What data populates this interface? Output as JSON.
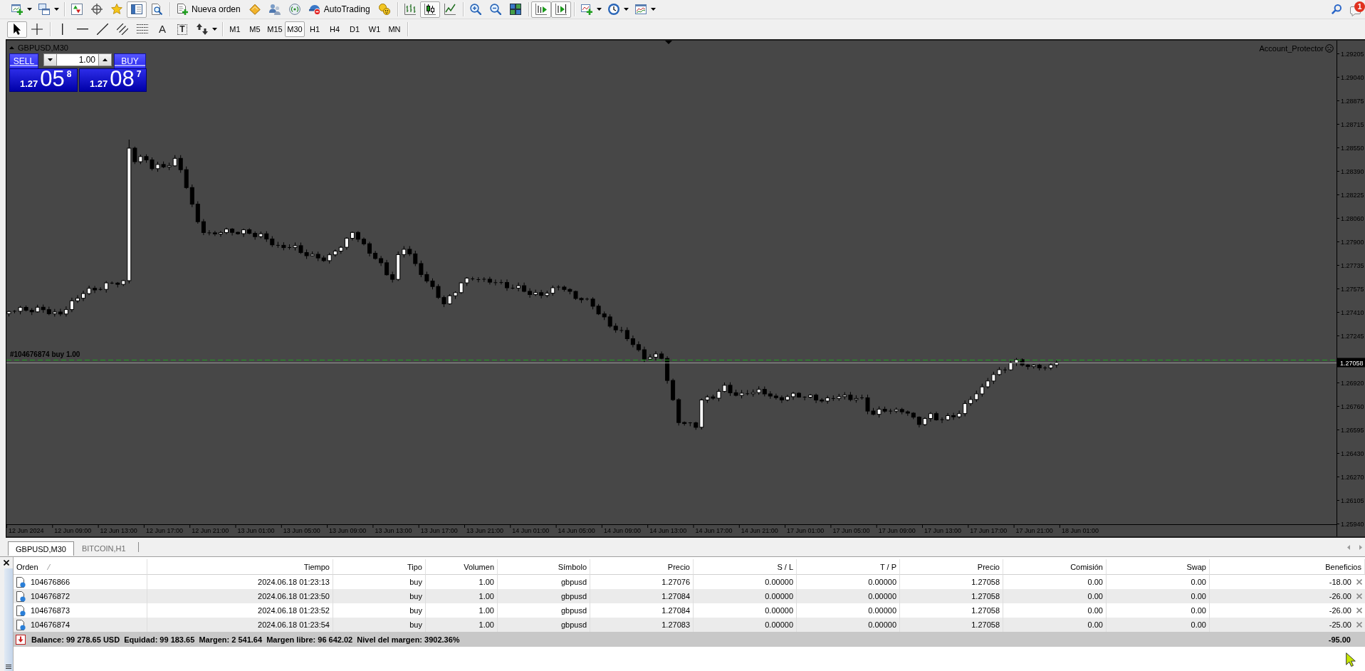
{
  "toolbar": {
    "items": [
      {
        "kind": "newchart",
        "on": false
      },
      {
        "kind": "profiles",
        "on": false
      },
      {
        "kind": "separator"
      },
      {
        "kind": "market",
        "on": false
      },
      {
        "kind": "navigator",
        "on": false
      },
      {
        "kind": "favorites",
        "on": false
      },
      {
        "kind": "datawindow",
        "on": true
      },
      {
        "kind": "tester",
        "on": false
      },
      {
        "kind": "separator"
      },
      {
        "kind": "order",
        "label": "Nueva orden",
        "on": false
      },
      {
        "kind": "editor",
        "on": false
      },
      {
        "kind": "terminal",
        "on": false
      },
      {
        "kind": "signals",
        "on": false
      },
      {
        "kind": "autotrading",
        "label": "AutoTrading",
        "on": false
      },
      {
        "kind": "experts",
        "on": false
      },
      {
        "kind": "separator"
      },
      {
        "kind": "bars",
        "on": false
      },
      {
        "kind": "candles",
        "on": true
      },
      {
        "kind": "line",
        "on": false
      },
      {
        "kind": "separator"
      },
      {
        "kind": "zoomin",
        "on": false
      },
      {
        "kind": "zoomout",
        "on": false
      },
      {
        "kind": "tile",
        "on": false
      },
      {
        "kind": "separator"
      },
      {
        "kind": "shift",
        "on": true
      },
      {
        "kind": "autoscroll",
        "on": true
      },
      {
        "kind": "separator"
      },
      {
        "kind": "indicators",
        "on": false
      },
      {
        "kind": "periods",
        "on": false
      },
      {
        "kind": "templates",
        "on": false
      }
    ]
  },
  "notifications": {
    "count": "1"
  },
  "drawing_toolbar": {
    "tools": [
      {
        "kind": "cursor",
        "on": true
      },
      {
        "kind": "crosshair",
        "on": false
      },
      {
        "kind": "separator"
      },
      {
        "kind": "vline",
        "on": false
      },
      {
        "kind": "hline",
        "on": false
      },
      {
        "kind": "trend",
        "on": false
      },
      {
        "kind": "channel",
        "on": false
      },
      {
        "kind": "fibo",
        "on": false
      },
      {
        "kind": "text",
        "glyph": "A",
        "on": false
      },
      {
        "kind": "label",
        "glyph": "T",
        "on": false
      },
      {
        "kind": "arrows",
        "on": false
      },
      {
        "kind": "separator"
      }
    ],
    "periods": [
      {
        "label": "M1",
        "selected": false
      },
      {
        "label": "M5",
        "selected": false
      },
      {
        "label": "M15",
        "selected": false
      },
      {
        "label": "M30",
        "selected": true
      },
      {
        "label": "H1",
        "selected": false
      },
      {
        "label": "H4",
        "selected": false
      },
      {
        "label": "D1",
        "selected": false
      },
      {
        "label": "W1",
        "selected": false
      },
      {
        "label": "MN",
        "selected": false
      }
    ]
  },
  "chart": {
    "symbol": "GBPUSD,M30",
    "expert": {
      "name": "Account_Protector",
      "active": false
    },
    "trade_panel": {
      "sell_label": "SELL",
      "buy_label": "BUY",
      "lot": "1.00",
      "sell_price": {
        "prefix": "1.27",
        "pips": "05",
        "fraction": "8"
      },
      "buy_price": {
        "prefix": "1.27",
        "pips": "08",
        "fraction": "7"
      }
    },
    "order_line_label": "#104676874 buy 1.00",
    "price_axis": [
      {
        "kind": "tick",
        "label": "1.29205"
      },
      {
        "kind": "tick",
        "label": "1.29040"
      },
      {
        "kind": "tick",
        "label": "1.28875"
      },
      {
        "kind": "tick",
        "label": "1.28715"
      },
      {
        "kind": "tick",
        "label": "1.28550"
      },
      {
        "kind": "tick",
        "label": "1.28390"
      },
      {
        "kind": "tick",
        "label": "1.28225"
      },
      {
        "kind": "tick",
        "label": "1.28060"
      },
      {
        "kind": "tick",
        "label": "1.27900"
      },
      {
        "kind": "tick",
        "label": "1.27735"
      },
      {
        "kind": "tick",
        "label": "1.27575"
      },
      {
        "kind": "tick",
        "label": "1.27410"
      },
      {
        "kind": "tick",
        "label": "1.27245"
      },
      {
        "kind": "current",
        "label": "1.27058"
      },
      {
        "kind": "tick",
        "label": "1.26920"
      },
      {
        "kind": "tick",
        "label": "1.26760"
      },
      {
        "kind": "tick",
        "label": "1.26595"
      },
      {
        "kind": "tick",
        "label": "1.26430"
      },
      {
        "kind": "tick",
        "label": "1.26270"
      },
      {
        "kind": "tick",
        "label": "1.26105"
      },
      {
        "kind": "tick",
        "label": "1.25940"
      }
    ],
    "time_axis": [
      "12 Jun 2024",
      "12 Jun 09:00",
      "12 Jun 13:00",
      "12 Jun 17:00",
      "12 Jun 21:00",
      "13 Jun 01:00",
      "13 Jun 05:00",
      "13 Jun 09:00",
      "13 Jun 13:00",
      "13 Jun 17:00",
      "13 Jun 21:00",
      "14 Jun 01:00",
      "14 Jun 05:00",
      "14 Jun 09:00",
      "14 Jun 13:00",
      "14 Jun 17:00",
      "14 Jun 21:00",
      "17 Jun 01:00",
      "17 Jun 05:00",
      "17 Jun 09:00",
      "17 Jun 13:00",
      "17 Jun 17:00",
      "17 Jun 21:00",
      "18 Jun 01:00"
    ]
  },
  "chart_tabs": [
    {
      "label": "GBPUSD,M30",
      "selected": true
    },
    {
      "label": "BITCOIN,H1",
      "selected": false
    }
  ],
  "terminal": {
    "columns": [
      {
        "label": "Orden",
        "sorted": true
      },
      {
        "label": "Tiempo",
        "sorted": false
      },
      {
        "label": "Tipo",
        "sorted": false
      },
      {
        "label": "Volumen",
        "sorted": false
      },
      {
        "label": "Símbolo",
        "sorted": false
      },
      {
        "label": "Precio",
        "sorted": false
      },
      {
        "label": "S / L",
        "sorted": false
      },
      {
        "label": "T / P",
        "sorted": false
      },
      {
        "label": "Precio",
        "sorted": false
      },
      {
        "label": "Comisión",
        "sorted": false
      },
      {
        "label": "Swap",
        "sorted": false
      },
      {
        "label": "Beneficios",
        "sorted": false
      }
    ],
    "rows": [
      {
        "cells": [
          "104676866",
          "2024.06.18 01:23:13",
          "buy",
          "1.00",
          "gbpusd",
          "1.27076",
          "0.00000",
          "0.00000",
          "1.27058",
          "0.00",
          "0.00",
          "-18.00"
        ]
      },
      {
        "cells": [
          "104676872",
          "2024.06.18 01:23:50",
          "buy",
          "1.00",
          "gbpusd",
          "1.27084",
          "0.00000",
          "0.00000",
          "1.27058",
          "0.00",
          "0.00",
          "-26.00"
        ]
      },
      {
        "cells": [
          "104676873",
          "2024.06.18 01:23:52",
          "buy",
          "1.00",
          "gbpusd",
          "1.27084",
          "0.00000",
          "0.00000",
          "1.27058",
          "0.00",
          "0.00",
          "-26.00"
        ]
      },
      {
        "cells": [
          "104676874",
          "2024.06.18 01:23:54",
          "buy",
          "1.00",
          "gbpusd",
          "1.27083",
          "0.00000",
          "0.00000",
          "1.27058",
          "0.00",
          "0.00",
          "-25.00"
        ]
      }
    ],
    "summary": {
      "text": "Balance: 99 278.65 USD  Equidad: 99 183.65  Margen: 2 541.64  Margen libre: 96 642.02  Nivel del margen: 3902.36%",
      "total": "-95.00"
    }
  }
}
